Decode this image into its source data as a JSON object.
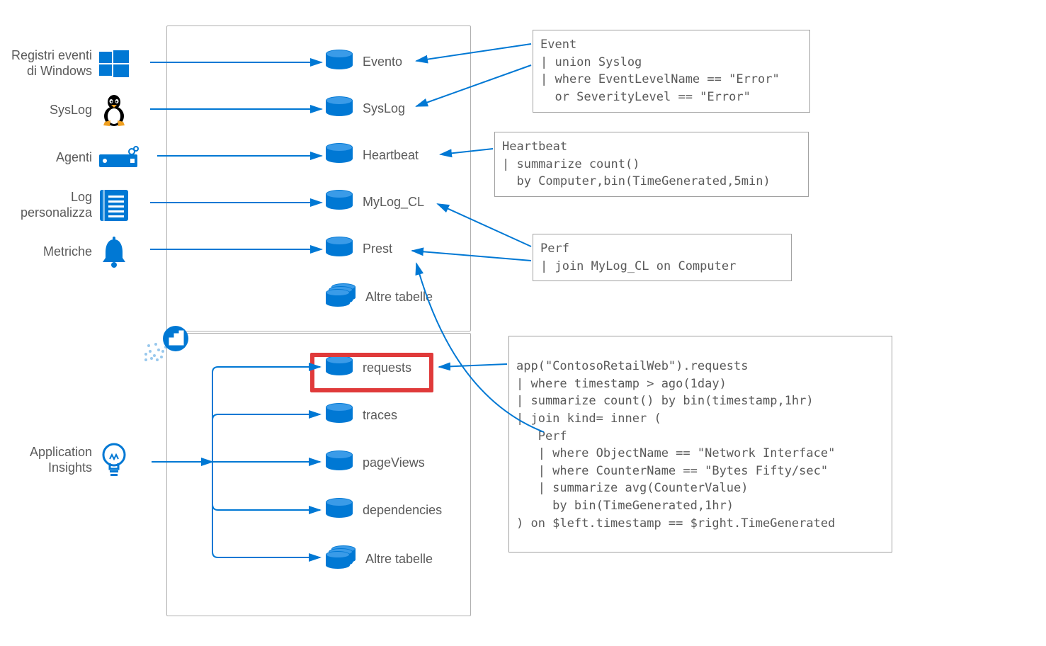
{
  "sources": [
    {
      "id": "winlogs",
      "label": "Registri eventi di Windows",
      "icon": "windows"
    },
    {
      "id": "syslog",
      "label": "SysLog",
      "icon": "linux"
    },
    {
      "id": "agents",
      "label": "Agenti",
      "icon": "server"
    },
    {
      "id": "customlogs",
      "label": "Log personalizza",
      "icon": "list"
    },
    {
      "id": "metrics",
      "label": "Metriche",
      "icon": "bell"
    },
    {
      "id": "appinsights",
      "label": "Application Insights",
      "icon": "bulb"
    }
  ],
  "tables_top": [
    {
      "id": "event",
      "label": "Evento",
      "multi": false
    },
    {
      "id": "syslogt",
      "label": "SysLog",
      "multi": false
    },
    {
      "id": "heartbeat",
      "label": "Heartbeat",
      "multi": false
    },
    {
      "id": "mylog",
      "label": "MyLog_CL",
      "multi": false
    },
    {
      "id": "perf",
      "label": "Prest",
      "multi": false
    },
    {
      "id": "other1",
      "label": "Altre tabelle",
      "multi": true
    }
  ],
  "tables_bottom": [
    {
      "id": "requests",
      "label": "requests",
      "multi": false,
      "highlight": true
    },
    {
      "id": "traces",
      "label": "traces",
      "multi": false
    },
    {
      "id": "pageviews",
      "label": "pageViews",
      "multi": false
    },
    {
      "id": "dependencies",
      "label": "dependencies",
      "multi": false
    },
    {
      "id": "other2",
      "label": "Altre tabelle",
      "multi": true
    }
  ],
  "code": {
    "event": "Event\n| union Syslog\n| where EventLevelName == \"Error\"\n  or SeverityLevel == \"Error\"",
    "heartbeat": "Heartbeat\n| summarize count()\n  by Computer,bin(TimeGenerated,5min)",
    "perf": "Perf\n| join MyLog_CL on Computer",
    "app": "app(\"ContosoRetailWeb\").requests\n| where timestamp > ago(1day)\n| summarize count() by bin(timestamp,1hr)\n| join kind= inner (\n   Perf\n   | where ObjectName == \"Network Interface\"\n   | where CounterName == \"Bytes Fifty/sec\"\n   | summarize avg(CounterValue)\n     by bin(TimeGenerated,1hr)\n) on $left.timestamp == $right.TimeGenerated"
  }
}
